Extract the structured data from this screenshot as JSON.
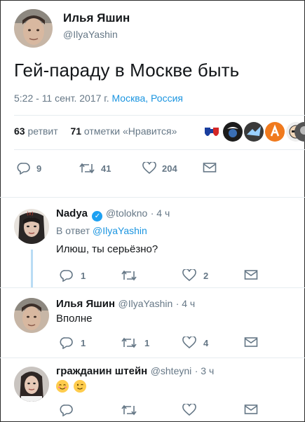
{
  "tweet": {
    "author_name": "Илья Яшин",
    "author_handle": "@IlyaYashin",
    "text": "Гей-параду в Москве быть",
    "time": "5:22 - 11 сент. 2017 г.",
    "location": "Москва, Россия",
    "retweets_count": "63",
    "retweets_label": "ретвит",
    "likes_count": "71",
    "likes_label": "отметки «Нравится»",
    "actions": {
      "replies": "9",
      "retweets": "41",
      "likes": "204"
    }
  },
  "replies": [
    {
      "name": "Nadya",
      "handle": "@tolokno",
      "age": "· 4 ч",
      "verified": true,
      "reply_to_prefix": "В ответ",
      "reply_to_handle": "@IlyaYashin",
      "text": "Илюш, ты серьёзно?",
      "counts": {
        "replies": "1",
        "retweets": "",
        "likes": "2"
      }
    },
    {
      "name": "Илья Яшин",
      "handle": "@IlyaYashin",
      "age": "· 4 ч",
      "text": "Вполне",
      "counts": {
        "replies": "1",
        "retweets": "1",
        "likes": "4"
      }
    },
    {
      "name": "гражданин штейн",
      "handle": "@shteyni",
      "age": "· 3 ч",
      "text_emojis": [
        "smiling-face-with-smiling-eyes",
        "winking-face"
      ],
      "counts": {
        "replies": "",
        "retweets": "",
        "likes": ""
      }
    }
  ],
  "colors": {
    "link": "#1b95e0",
    "muted": "#657786",
    "thread": "#b9dcf4",
    "verified": "#1da1f2"
  }
}
